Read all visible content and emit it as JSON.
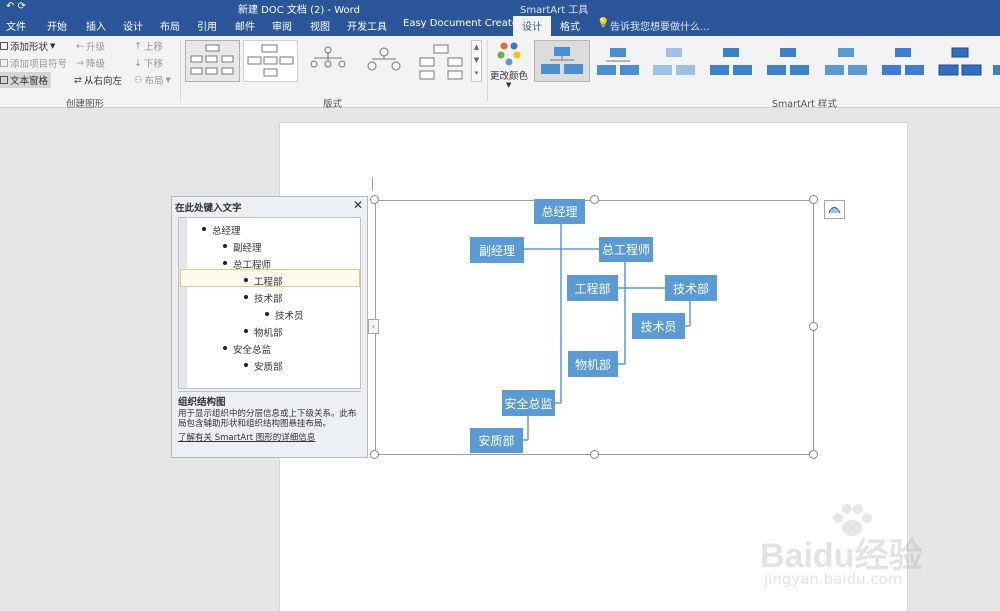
{
  "window": {
    "title": "新建 DOC 文档 (2) - Word",
    "context_tab_title": "SmartArt 工具"
  },
  "tabs": [
    "文件",
    "开始",
    "插入",
    "设计",
    "布局",
    "引用",
    "邮件",
    "审阅",
    "视图",
    "开发工具",
    "Easy Document Creator",
    "设计",
    "格式"
  ],
  "tell_me": "告诉我您想要做什么...",
  "ribbon": {
    "create_group": {
      "add_shape": "添加形状",
      "add_bullet": "添加项目符号",
      "text_pane": "文本窗格",
      "promote": "升级",
      "demote": "降级",
      "rtl": "从右向左",
      "move_up": "上移",
      "move_down": "下移",
      "layout": "布局",
      "label": "创建图形"
    },
    "layout_group": {
      "label": "版式"
    },
    "change_colors": "更改颜色",
    "styles_group": {
      "label": "SmartArt 样式"
    }
  },
  "text_pane": {
    "title": "在此处键入文字",
    "items": [
      {
        "text": "总经理",
        "level": 0
      },
      {
        "text": "副经理",
        "level": 1
      },
      {
        "text": "总工程师",
        "level": 1
      },
      {
        "text": "工程部",
        "level": 2
      },
      {
        "text": "技术部",
        "level": 2
      },
      {
        "text": "技术员",
        "level": 3
      },
      {
        "text": "物机部",
        "level": 2
      },
      {
        "text": "安全总监",
        "level": 1
      },
      {
        "text": "安质部",
        "level": 2
      }
    ],
    "desc_title": "组织结构图",
    "desc_text": "用于显示组织中的分层信息或上下级关系。此布局包含辅助形状和组织结构图悬挂布局。",
    "learn_more": "了解有关 SmartArt 图形的详细信息"
  },
  "diagram": {
    "nodes": {
      "gm": "总经理",
      "dgm": "副经理",
      "ce": "总工程师",
      "eng": "工程部",
      "tech": "技术部",
      "tech_staff": "技术员",
      "mech": "物机部",
      "safety": "安全总监",
      "qa": "安质部"
    },
    "fill_color": "#5b9bd5",
    "line_color": "#5b9bd5"
  },
  "watermark": {
    "brand": "Baidu经验",
    "url": "jingyan.baidu.com"
  }
}
